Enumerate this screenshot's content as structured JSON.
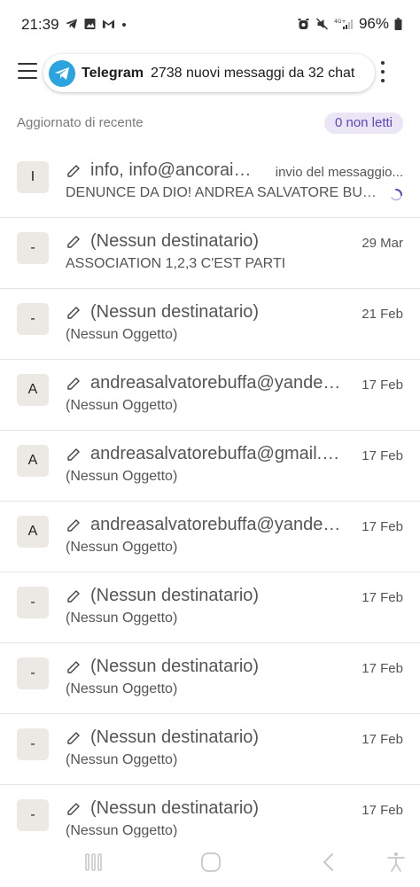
{
  "status_bar": {
    "time": "21:39",
    "battery": "96%",
    "left_icons": [
      "telegram-icon",
      "gallery-icon",
      "gmail-icon",
      "dot-icon"
    ],
    "right_icons": [
      "alarm-icon",
      "mute-icon",
      "4g-signal-icon",
      "battery-icon"
    ]
  },
  "notification": {
    "app": "Telegram",
    "text": "2738 nuovi messaggi da 32 chat",
    "accent": "#2aa3df"
  },
  "section": {
    "title": "Aggiornato di recente",
    "unread_badge": "0 non letti"
  },
  "mails": [
    {
      "avatar": "I",
      "sender": "info, info@ancoraisopetra.it",
      "date": "invio del messaggio...",
      "subject": "DENUNCE DA DIO! ANDREA SALVATORE BUFFA"
    },
    {
      "avatar": "-",
      "sender": "(Nessun destinatario)",
      "date": "29 Mar",
      "subject": "ASSOCIATION 1,2,3 C'EST PARTI"
    },
    {
      "avatar": "-",
      "sender": "(Nessun destinatario)",
      "date": "21 Feb",
      "subject": "(Nessun Oggetto)"
    },
    {
      "avatar": "A",
      "sender": "andreasalvatorebuffa@yandex.com",
      "date": "17 Feb",
      "subject": "(Nessun Oggetto)"
    },
    {
      "avatar": "A",
      "sender": "andreasalvatorebuffa@gmail.com",
      "date": "17 Feb",
      "subject": "(Nessun Oggetto)"
    },
    {
      "avatar": "A",
      "sender": "andreasalvatorebuffa@yandex.com",
      "date": "17 Feb",
      "subject": "(Nessun Oggetto)"
    },
    {
      "avatar": "-",
      "sender": "(Nessun destinatario)",
      "date": "17 Feb",
      "subject": "(Nessun Oggetto)"
    },
    {
      "avatar": "-",
      "sender": "(Nessun destinatario)",
      "date": "17 Feb",
      "subject": "(Nessun Oggetto)"
    },
    {
      "avatar": "-",
      "sender": "(Nessun destinatario)",
      "date": "17 Feb",
      "subject": "(Nessun Oggetto)"
    },
    {
      "avatar": "-",
      "sender": "(Nessun destinatario)",
      "date": "17 Feb",
      "subject": "(Nessun Oggetto)"
    }
  ],
  "nav": [
    "recents-icon",
    "home-icon",
    "back-icon",
    "accessibility-icon"
  ],
  "colors": {
    "badge_bg": "#eae6f6",
    "badge_text": "#5b47b8",
    "spinner": "#5b47b8"
  }
}
